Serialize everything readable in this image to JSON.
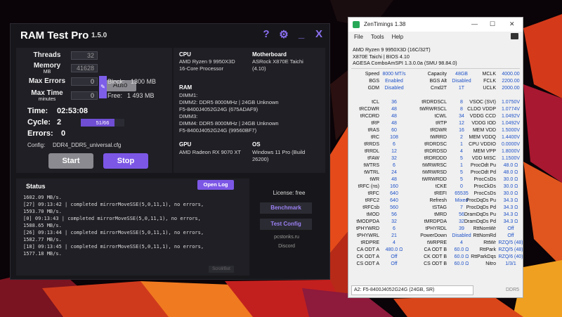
{
  "ramtest": {
    "title": "RAM Test Pro",
    "version": "1.5.0",
    "icons": {
      "help": "?",
      "settings": "⚙",
      "minimize": "_",
      "close": "X"
    },
    "threads_label": "Threads",
    "threads_value": "32",
    "auto_label": "Auto",
    "memory_label": "Memory",
    "memory_unit": "MB",
    "memory_value": "41628",
    "max_errors_label": "Max Errors",
    "max_errors_value": "0",
    "max_time_label": "Max Time",
    "max_time_unit": "minutes",
    "max_time_value": "0",
    "block_label": "Block:",
    "block_value": "1300 MB",
    "free_label": "Free:",
    "free_value": "1 493 MB",
    "time_label": "Time:",
    "time_value": "02:53:08",
    "cycle_label": "Cycle:",
    "cycle_value": "2",
    "progress_text": "51/66",
    "progress_fraction": 0.773,
    "errors_label": "Errors:",
    "errors_value": "0",
    "config_label": "Config:",
    "config_value": "DDR4_DDR5_universal.cfg",
    "start_label": "Start",
    "stop_label": "Stop",
    "cpu_h": "CPU",
    "cpu_1": "AMD Ryzen 9 9950X3D",
    "cpu_2": "16-Core Processor",
    "mb_h": "Motherboard",
    "mb_1": "ASRock X870E Taichi",
    "mb_2": "(4.10)",
    "ram_h": "RAM",
    "ram_1": "DIMM1:",
    "ram_2": "DIMM2: DDR5 8000MHz | 24GB Unknown",
    "ram_3": "F5-8400J4052G24G (675ADAF9)",
    "ram_4": "DIMM3:",
    "ram_5": "DIMM4: DDR5 8000MHz | 24GB Unknown",
    "ram_6": "F5-8400J4052G24G (99560BF7)",
    "gpu_h": "GPU",
    "gpu_1": "AMD Radeon RX 9070 XT",
    "os_h": "OS",
    "os_1": "Windows 11 Pro (Build",
    "os_2": "26200)",
    "status_title": "Status",
    "open_log": "Open Log",
    "log": "1602.09 MB/s.\n[27] 09:13:42 | completed mirrorMoveSSE(5,0,11,1), no errors,\n1593.70 MB/s.\n[0] 09:13:43 | completed mirrorMoveSSE(5,0,11,1), no errors,\n1588.65 MB/s.\n[26] 09:13:44 | completed mirrorMoveSSE(5,0,11,1), no errors,\n1582.77 MB/s.\n[18] 09:13:45 | completed mirrorMoveSSE(5,0,11,1), no errors,\n1577.18 MB/s.",
    "scroll_label": "Scroll/Bot",
    "license": "License: free",
    "benchmark": "Benchmark",
    "test_config": "Test Config",
    "site": "pcstonks.ru",
    "discord": "Discord"
  },
  "zen": {
    "title": "ZenTimings 1.38",
    "menu": [
      "File",
      "Tools",
      "Help"
    ],
    "info": [
      "AMD Ryzen 9 9950X3D (16C/32T)",
      "X870E Taichi | BIOS 4.10",
      "AGESA ComboAmSPI 1.3.0.0a (SMU 98.84.0)"
    ],
    "rows": [
      [
        "Speed",
        "8000 MT/s",
        "Capacity",
        "48GB",
        "MCLK",
        "4000.00"
      ],
      [
        "BGS",
        "Enabled",
        "BGS Alt",
        "Disabled",
        "FCLK",
        "2200.00"
      ],
      [
        "GDM",
        "Disabled",
        "Cmd2T",
        "1T",
        "UCLK",
        "2000.00"
      ],
      [
        "",
        "",
        "",
        "",
        "",
        ""
      ],
      [
        "tCL",
        "36",
        "tRDRDSCL",
        "8",
        "VSOC (SVI)",
        "1.0750V"
      ],
      [
        "tRCDWR",
        "48",
        "tWRWRSCL",
        "8",
        "CLDO VDDP",
        "1.0774V"
      ],
      [
        "tRCDRD",
        "48",
        "tCWL",
        "34",
        "VDDG CCD",
        "1.0492V"
      ],
      [
        "tRP",
        "48",
        "tRTP",
        "12",
        "VDDG IOD",
        "1.0492V"
      ],
      [
        "tRAS",
        "60",
        "tRDWR",
        "16",
        "MEM VDD",
        "1.5000V"
      ],
      [
        "tRC",
        "108",
        "tWRRD",
        "2",
        "MEM VDDQ",
        "1.4400V"
      ],
      [
        "tRRDS",
        "6",
        "tRDRDSC",
        "1",
        "CPU VDDIO",
        "0.0000V"
      ],
      [
        "tRRDL",
        "12",
        "tRDRDSD",
        "4",
        "MEM VPP",
        "1.8000V"
      ],
      [
        "tFAW",
        "32",
        "tRDRDDD",
        "5",
        "VDD MISC",
        "1.1500V"
      ],
      [
        "tWTRS",
        "6",
        "tWRWRSC",
        "1",
        "ProcOdt Pu",
        "48.0 Ω"
      ],
      [
        "tWTRL",
        "24",
        "tWRWRSD",
        "5",
        "ProcOdt Pd",
        "48.0 Ω"
      ],
      [
        "tWR",
        "48",
        "tWRWRDD",
        "5",
        "ProcCsDs",
        "30.0 Ω"
      ],
      [
        "tRFC (ns)",
        "160",
        "tCKE",
        "0",
        "ProcCkDs",
        "30.0 Ω"
      ],
      [
        "tRFC",
        "640",
        "tREFI",
        "65535",
        "ProcCsDs",
        "30.0 Ω"
      ],
      [
        "tRFC2",
        "640",
        "Refresh",
        "Mixed",
        "ProcDqDs Pu",
        "34.3 Ω"
      ],
      [
        "tRFCsb",
        "560",
        "tSTAG",
        "7",
        "ProcDqDs Pd",
        "34.3 Ω"
      ],
      [
        "tMOD",
        "56",
        "tMRD",
        "56",
        "DramDqDs Pu",
        "34.3 Ω"
      ],
      [
        "tMODPDA",
        "32",
        "tMRDPDA",
        "32",
        "DramDqDs Pd",
        "34.3 Ω"
      ],
      [
        "tPHYWRD",
        "6",
        "tPHYRDL",
        "39",
        "RttNomWr",
        "Off"
      ],
      [
        "tPHYWRL",
        "21",
        "PowerDown",
        "Disabled",
        "RttNomRd",
        "Off"
      ],
      [
        "tRDPRE",
        "4",
        "tWRPRE",
        "4",
        "RttWr",
        "RZQ/5 (48)"
      ],
      [
        "CA ODT A",
        "480.0 Ω",
        "CA ODT B",
        "60.0 Ω",
        "RttPark",
        "RZQ/5 (48)"
      ],
      [
        "CK ODT A",
        "Off",
        "CK ODT B",
        "60.0 Ω",
        "RttParkDqs",
        "RZQ/6 (40)"
      ],
      [
        "CS ODT A",
        "Off",
        "CS ODT B",
        "60.0 Ω",
        "Nitro",
        "1/3/1"
      ]
    ],
    "dimm_select": "A2: F5-8400J4052G24G (24GB, SR)",
    "ddr": "DDR5"
  }
}
